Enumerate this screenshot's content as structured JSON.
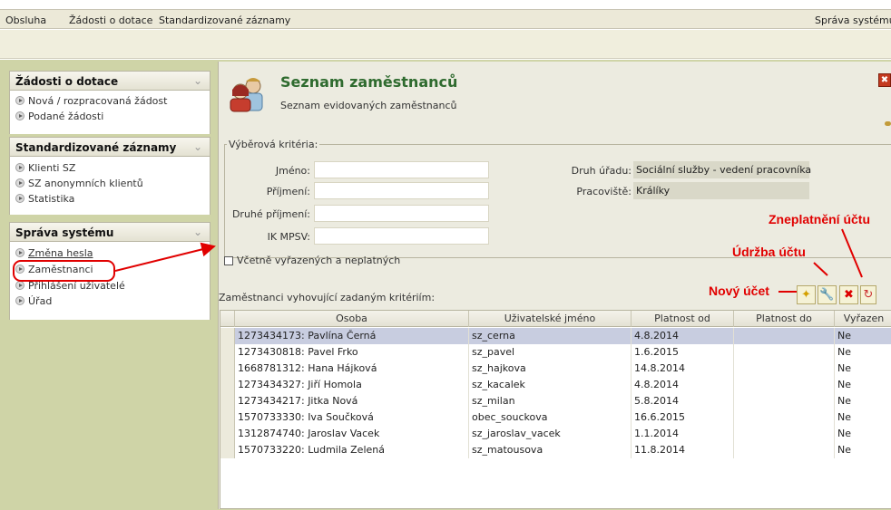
{
  "menubar": {
    "items": [
      {
        "label": "Obsluha"
      },
      {
        "label": "Žádosti o dotace"
      },
      {
        "label": "Standardizované záznamy"
      }
    ],
    "right_label": "Správa systému"
  },
  "sidebar": {
    "sections": [
      {
        "title": "Žádosti o dotace",
        "items": [
          "Nová / rozpracovaná žádost",
          "Podané žádosti"
        ]
      },
      {
        "title": "Standardizované záznamy",
        "items": [
          "Klienti SZ",
          "SZ anonymních klientů",
          "Statistika"
        ]
      },
      {
        "title": "Správa systému",
        "items": [
          "Změna hesla",
          "Zaměstnanci",
          "Přihlášení uživatelé",
          "Úřad"
        ]
      }
    ]
  },
  "header": {
    "title": "Seznam zaměstnanců",
    "subtitle": "Seznam evidovaných zaměstnanců"
  },
  "criteria": {
    "legend": "Výběrová kritéria:",
    "fields": {
      "jmeno": {
        "label": "Jméno:",
        "value": ""
      },
      "prijmeni": {
        "label": "Příjmení:",
        "value": ""
      },
      "druhe_prijmeni": {
        "label": "Druhé příjmení:",
        "value": ""
      },
      "ik_mpsv": {
        "label": "IK MPSV:",
        "value": ""
      },
      "druh_uradu": {
        "label": "Druh úřadu:",
        "value": "Sociální služby - vedení pracovníka"
      },
      "pracoviste": {
        "label": "Pracoviště:",
        "value": "Králíky"
      }
    },
    "include_checkbox": {
      "label": "Včetně vyřazených a neplatných",
      "checked": false
    }
  },
  "list": {
    "caption": "Zaměstnanci vyhovující zadaným kritériím:",
    "columns": [
      "Osoba",
      "Uživatelské jméno",
      "Platnost od",
      "Platnost do",
      "Vyřazen"
    ],
    "rows": [
      {
        "osoba": "1273434173: Pavlína Černá",
        "uzivatel": "sz_cerna",
        "od": "4.8.2014",
        "do": "",
        "vyrazen": "Ne",
        "selected": true
      },
      {
        "osoba": "1273430818: Pavel Frko",
        "uzivatel": "sz_pavel",
        "od": "1.6.2015",
        "do": "",
        "vyrazen": "Ne"
      },
      {
        "osoba": "1668781312: Hana Hájková",
        "uzivatel": "sz_hajkova",
        "od": "14.8.2014",
        "do": "",
        "vyrazen": "Ne"
      },
      {
        "osoba": "1273434327: Jiří Homola",
        "uzivatel": "sz_kacalek",
        "od": "4.8.2014",
        "do": "",
        "vyrazen": "Ne"
      },
      {
        "osoba": "1273434217: Jitka Nová",
        "uzivatel": "sz_milan",
        "od": "5.8.2014",
        "do": "",
        "vyrazen": "Ne"
      },
      {
        "osoba": "1570733330: Iva Součková",
        "uzivatel": "obec_souckova",
        "od": "16.6.2015",
        "do": "",
        "vyrazen": "Ne"
      },
      {
        "osoba": "1312874740: Jaroslav Vacek",
        "uzivatel": "sz_jaroslav_vacek",
        "od": "1.1.2014",
        "do": "",
        "vyrazen": "Ne"
      },
      {
        "osoba": "1570733220: Ludmila Zelená",
        "uzivatel": "sz_matousova",
        "od": "11.8.2014",
        "do": "",
        "vyrazen": "Ne"
      }
    ]
  },
  "annotations": {
    "novy_ucet": "Nový účet",
    "udrzba_uctu": "Údržba účtu",
    "zneplatneni_uctu": "Zneplatnění účtu"
  },
  "colors": {
    "accent_green": "#2f6b2f",
    "annotation_red": "#e10000",
    "selected_row": "#c8cde0"
  }
}
